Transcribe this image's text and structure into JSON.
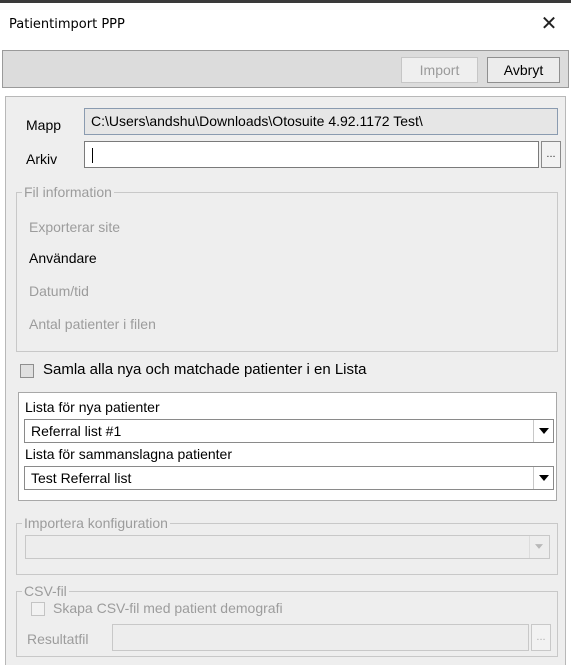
{
  "window": {
    "title": "Patientimport PPP",
    "close_glyph": "✕"
  },
  "toolbar": {
    "import_label": "Import",
    "cancel_label": "Avbryt"
  },
  "form": {
    "mapp_label": "Mapp",
    "mapp_value": "C:\\Users\\andshu\\Downloads\\Otosuite 4.92.1172 Test\\",
    "arkiv_label": "Arkiv",
    "arkiv_value": "",
    "browse_label": "..."
  },
  "file_info": {
    "legend": "Fil information",
    "exporting_site": "Exporterar site",
    "user": "Användare",
    "datetime": "Datum/tid",
    "patient_count": "Antal patienter i filen"
  },
  "collect_checkbox": {
    "label": "Samla alla nya och matchade patienter i en Lista",
    "checked": false
  },
  "lists": {
    "new_patients_label": "Lista för nya patienter",
    "new_patients_value": "Referral list #1",
    "merged_patients_label": "Lista för sammanslagna patienter",
    "merged_patients_value": "Test Referral list"
  },
  "import_config": {
    "legend": "Importera konfiguration",
    "value": ""
  },
  "csv": {
    "legend": "CSV-fil",
    "checkbox_label": "Skapa CSV-fil med patient demografi",
    "checked": false,
    "result_label": "Resultatfil",
    "result_value": "",
    "browse_label": "..."
  }
}
